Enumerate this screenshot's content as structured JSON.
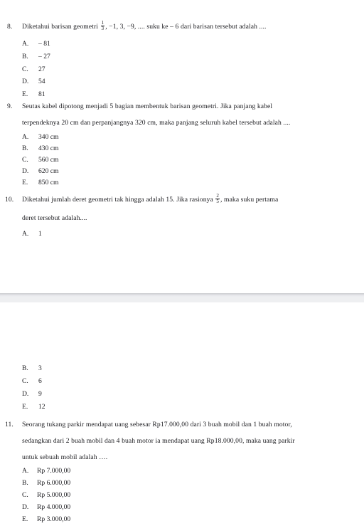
{
  "document": {
    "background_color": "#ffffff",
    "text_color": "#1b1b1f",
    "page_gap_color": "#eeeff1"
  },
  "questions": [
    {
      "number": "8.",
      "lines": [
        {
          "segments": [
            {
              "type": "text",
              "value": "Diketahui barisan geometri "
            },
            {
              "type": "fraction",
              "numerator": "1",
              "denominator": "3"
            },
            {
              "type": "text",
              "value": ", −1, 3, −9, ....  suku ke – 6 dari barisan tersebut adalah ...."
            }
          ]
        }
      ],
      "options": [
        {
          "letter": "A.",
          "value": "– 81"
        },
        {
          "letter": "B.",
          "value": "– 27"
        },
        {
          "letter": "C.",
          "value": "27"
        },
        {
          "letter": "D.",
          "value": "54"
        },
        {
          "letter": "E.",
          "value": "81"
        }
      ]
    },
    {
      "number": "9.",
      "lines": [
        {
          "segments": [
            {
              "type": "text",
              "value": "Seutas kabel dipotong menjadi 5 bagian membentuk barisan geometri. Jika panjang kabel"
            }
          ]
        },
        {
          "segments": [
            {
              "type": "text",
              "value": "terpendeknya 20 cm dan perpanjangnya 320 cm, maka panjang seluruh kabel tersebut adalah ...."
            }
          ]
        }
      ],
      "options": [
        {
          "letter": "A.",
          "value": "340 cm"
        },
        {
          "letter": "B.",
          "value": "430 cm"
        },
        {
          "letter": "C.",
          "value": "560 cm"
        },
        {
          "letter": "D.",
          "value": "620 cm"
        },
        {
          "letter": "E.",
          "value": "850 cm"
        }
      ]
    },
    {
      "number": "10.",
      "lines": [
        {
          "segments": [
            {
              "type": "text",
              "value": "Diketahui jumlah deret geometri tak hingga adalah 15. Jika rasionya "
            },
            {
              "type": "fraction",
              "numerator": "2",
              "denominator": "5"
            },
            {
              "type": "text",
              "value": ", maka suku pertama"
            }
          ]
        },
        {
          "segments": [
            {
              "type": "text",
              "value": "deret tersebut adalah...."
            }
          ]
        }
      ],
      "options": [
        {
          "letter": "A.",
          "value": "1"
        },
        {
          "letter": "B.",
          "value": "3"
        },
        {
          "letter": "C.",
          "value": "6"
        },
        {
          "letter": "D.",
          "value": "9"
        },
        {
          "letter": "E.",
          "value": "12"
        }
      ]
    },
    {
      "number": "11.",
      "lines": [
        {
          "segments": [
            {
              "type": "text",
              "value": "Seorang tukang parkir mendapat uang sebesar Rp17.000,00 dari 3 buah mobil dan 1 buah motor,"
            }
          ]
        },
        {
          "segments": [
            {
              "type": "text",
              "value": "sedangkan dari 2 buah mobil dan 4 buah motor ia mendapat uang Rp18.000,00, maka uang parkir"
            }
          ]
        },
        {
          "segments": [
            {
              "type": "text",
              "value": "untuk sebuah mobil adalah …."
            }
          ]
        }
      ],
      "options": [
        {
          "letter": "A.",
          "value": "Rp 7.000,00"
        },
        {
          "letter": "B.",
          "value": "Rp 6.000,00"
        },
        {
          "letter": "C.",
          "value": "Rp 5.000,00"
        },
        {
          "letter": "D.",
          "value": "Rp 4.000,00"
        },
        {
          "letter": "E.",
          "value": "Rp 3.000,00"
        }
      ]
    }
  ]
}
